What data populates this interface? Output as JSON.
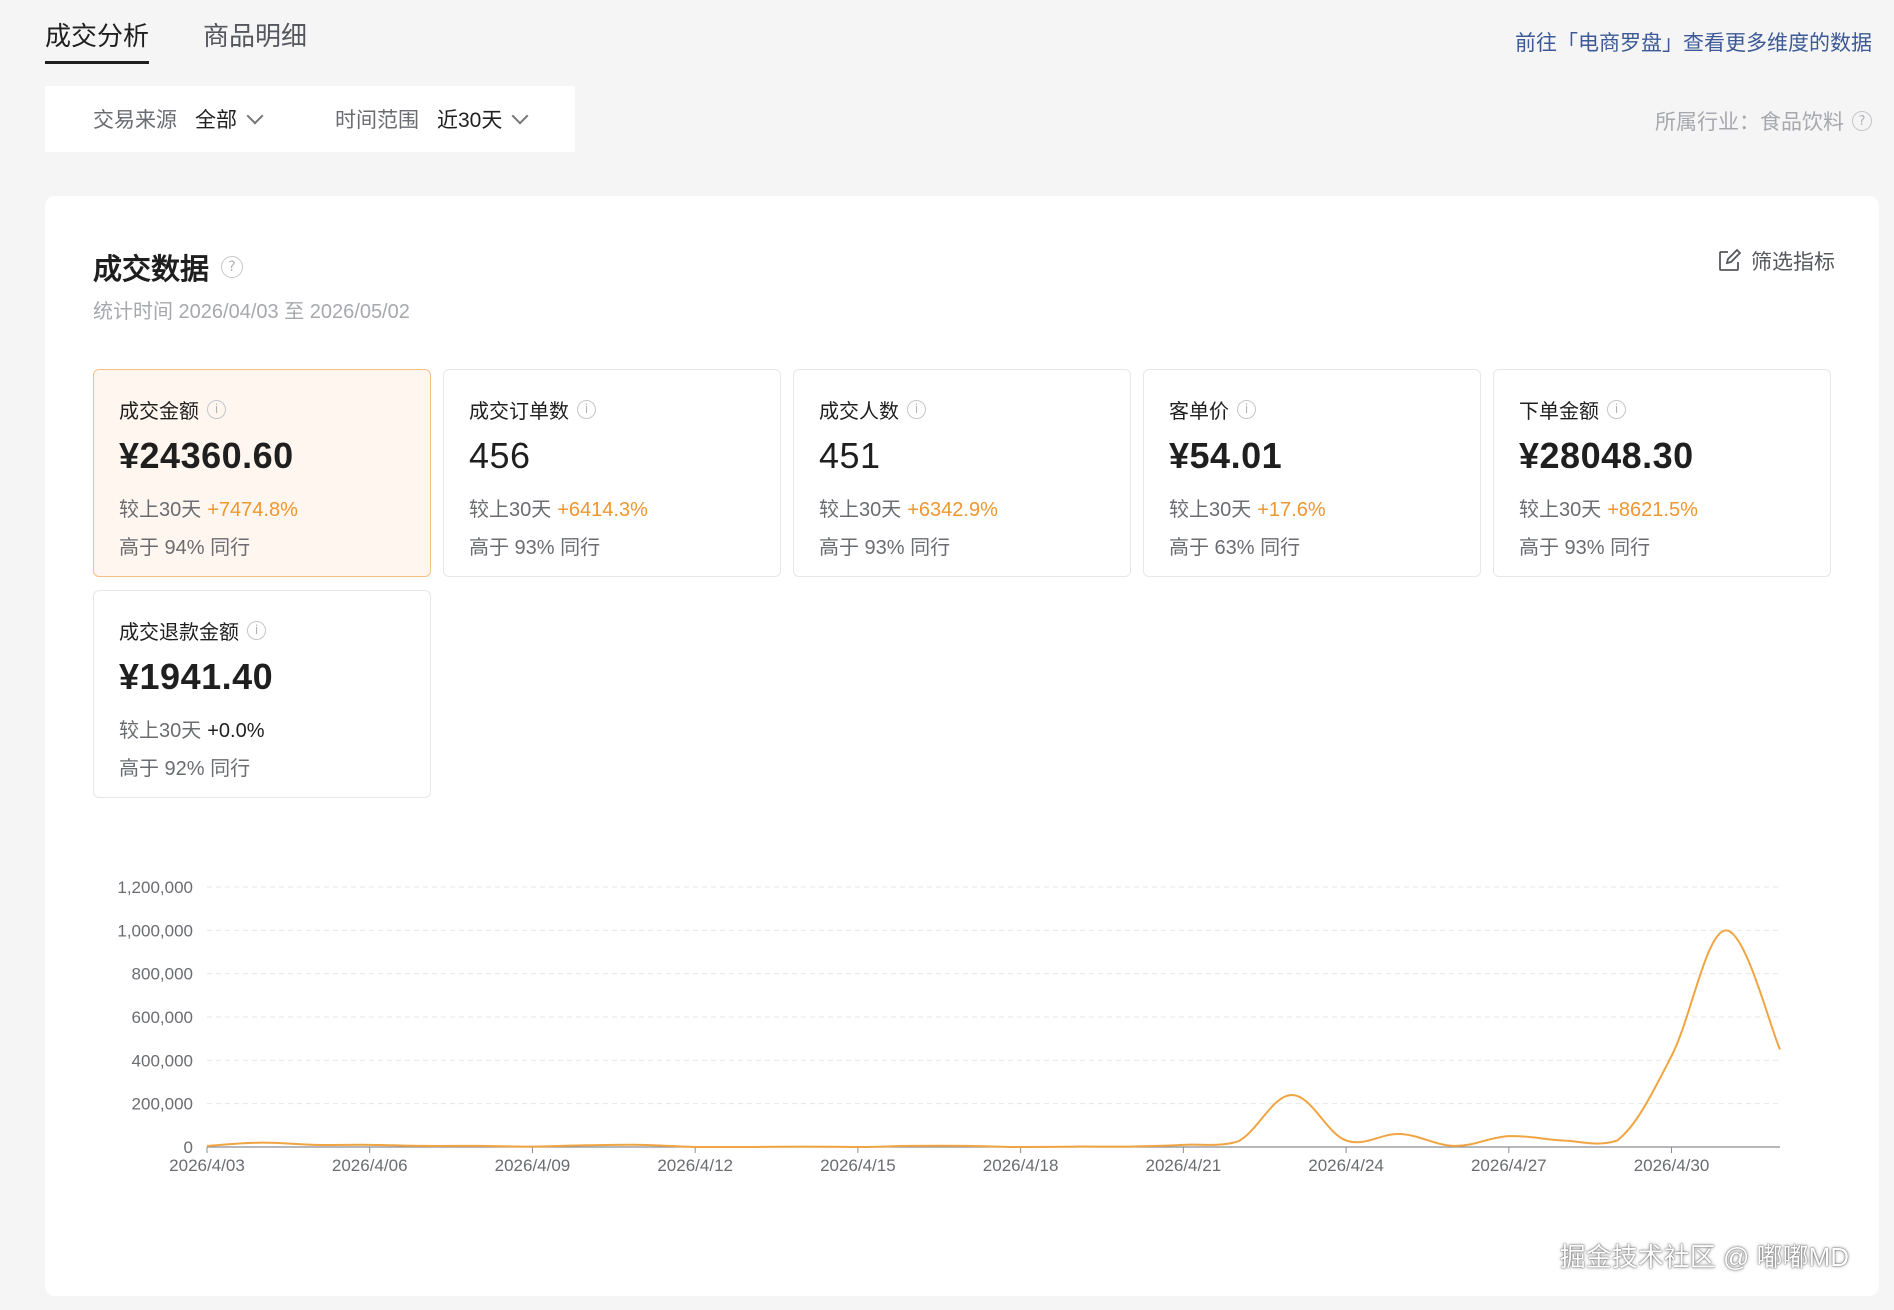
{
  "tabs": [
    {
      "label": "成交分析",
      "active": true
    },
    {
      "label": "商品明细",
      "active": false
    }
  ],
  "compass_link": "前往「电商罗盘」查看更多维度的数据",
  "filters": [
    {
      "label": "交易来源",
      "value": "全部"
    },
    {
      "label": "时间范围",
      "value": "近30天"
    }
  ],
  "industry": "所属行业：食品饮料",
  "panel": {
    "title": "成交数据",
    "stat_time": "统计时间 2026/04/03 至 2026/05/02",
    "filter_metrics": "筛选指标"
  },
  "cards": [
    {
      "title": "成交金额",
      "value": "¥24360.60",
      "compare_label": "较上30天",
      "delta": "+7474.8%",
      "peer": "高于 94% 同行",
      "selected": true
    },
    {
      "title": "成交订单数",
      "value": "456",
      "compare_label": "较上30天",
      "delta": "+6414.3%",
      "peer": "高于 93% 同行"
    },
    {
      "title": "成交人数",
      "value": "451",
      "compare_label": "较上30天",
      "delta": "+6342.9%",
      "peer": "高于 93% 同行"
    },
    {
      "title": "客单价",
      "value": "¥54.01",
      "compare_label": "较上30天",
      "delta": "+17.6%",
      "peer": "高于 63% 同行"
    },
    {
      "title": "下单金额",
      "value": "¥28048.30",
      "compare_label": "较上30天",
      "delta": "+8621.5%",
      "peer": "高于 93% 同行"
    },
    {
      "title": "成交退款金额",
      "value": "¥1941.40",
      "compare_label": "较上30天",
      "delta": "+0.0%",
      "peer": "高于 92% 同行",
      "flat": true
    }
  ],
  "colors": {
    "accent": "#f0962e",
    "line": "#f0a542",
    "link": "#3d5a96"
  },
  "chart_data": {
    "type": "line",
    "x": [
      "2026/4/03",
      "2026/4/04",
      "2026/4/05",
      "2026/4/06",
      "2026/4/07",
      "2026/4/08",
      "2026/4/09",
      "2026/4/10",
      "2026/4/11",
      "2026/4/12",
      "2026/4/13",
      "2026/4/14",
      "2026/4/15",
      "2026/4/16",
      "2026/4/17",
      "2026/4/18",
      "2026/4/19",
      "2026/4/20",
      "2026/4/21",
      "2026/4/22",
      "2026/4/23",
      "2026/4/24",
      "2026/4/25",
      "2026/4/26",
      "2026/4/27",
      "2026/4/28",
      "2026/4/29",
      "2026/4/30",
      "2026/5/01",
      "2026/5/02"
    ],
    "values": [
      5000,
      20000,
      10000,
      10000,
      5000,
      5000,
      2000,
      8000,
      10000,
      0,
      0,
      2000,
      0,
      5000,
      5000,
      0,
      2000,
      2000,
      10000,
      25000,
      240000,
      30000,
      60000,
      5000,
      50000,
      30000,
      30000,
      420000,
      1000000,
      450000
    ],
    "xticks": [
      "2026/4/03",
      "2026/4/06",
      "2026/4/09",
      "2026/4/12",
      "2026/4/15",
      "2026/4/18",
      "2026/4/21",
      "2026/4/24",
      "2026/4/27",
      "2026/4/30"
    ],
    "yticks": [
      "0",
      "200,000",
      "400,000",
      "600,000",
      "800,000",
      "1,000,000",
      "1,200,000"
    ],
    "ylim": [
      0,
      1200000
    ],
    "grid": true
  },
  "watermark": "掘金技术社区 @ 嘟嘟MD"
}
